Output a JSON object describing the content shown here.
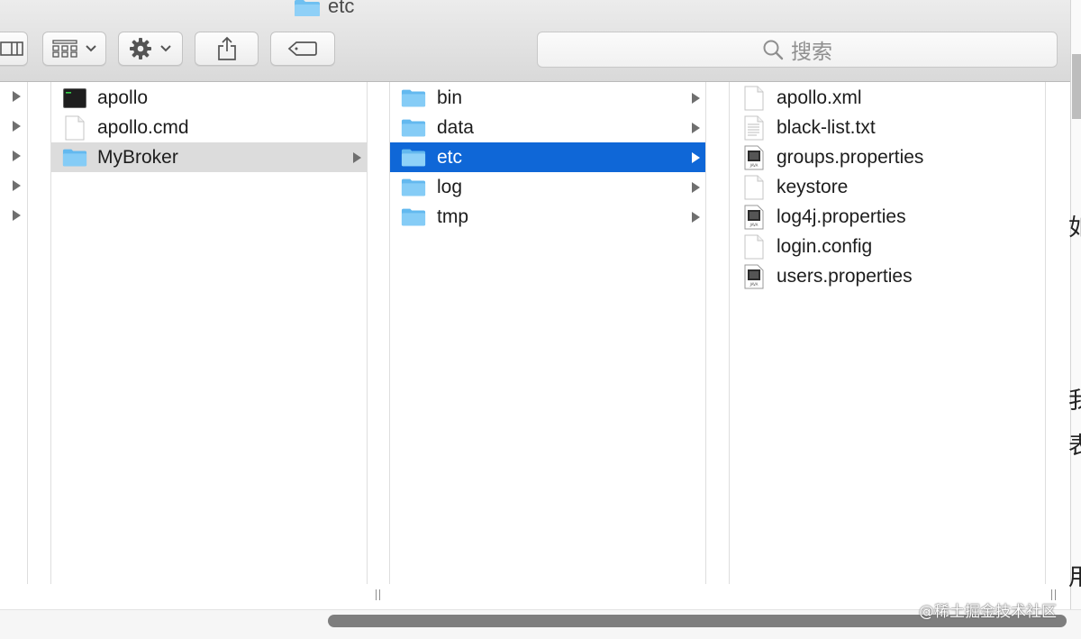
{
  "window": {
    "title": "etc"
  },
  "toolbar": {
    "view_button_icon": "column-view-icon",
    "arrange_button_icon": "grid-arrange-icon",
    "action_button_icon": "gear-icon",
    "share_button_icon": "share-icon",
    "tags_button_icon": "tag-icon",
    "search_placeholder": "搜索",
    "search_icon": "magnifier-icon"
  },
  "sidebar": {
    "arrow_count": 5
  },
  "columns": [
    {
      "items": [
        {
          "label": "apollo",
          "icon": "terminal-exec-icon",
          "has_arrow": false,
          "selected": "none"
        },
        {
          "label": "apollo.cmd",
          "icon": "document-icon",
          "has_arrow": false,
          "selected": "none"
        },
        {
          "label": "MyBroker",
          "icon": "folder-icon",
          "has_arrow": true,
          "selected": "inactive"
        }
      ]
    },
    {
      "items": [
        {
          "label": "bin",
          "icon": "folder-icon",
          "has_arrow": true,
          "selected": "none"
        },
        {
          "label": "data",
          "icon": "folder-icon",
          "has_arrow": true,
          "selected": "none"
        },
        {
          "label": "etc",
          "icon": "folder-icon",
          "has_arrow": true,
          "selected": "active"
        },
        {
          "label": "log",
          "icon": "folder-icon",
          "has_arrow": true,
          "selected": "none"
        },
        {
          "label": "tmp",
          "icon": "folder-icon",
          "has_arrow": true,
          "selected": "none"
        }
      ]
    },
    {
      "items": [
        {
          "label": "apollo.xml",
          "icon": "document-icon",
          "has_arrow": false,
          "selected": "none"
        },
        {
          "label": "black-list.txt",
          "icon": "text-document-icon",
          "has_arrow": false,
          "selected": "none"
        },
        {
          "label": "groups.properties",
          "icon": "java-file-icon",
          "has_arrow": false,
          "selected": "none"
        },
        {
          "label": "keystore",
          "icon": "document-icon",
          "has_arrow": false,
          "selected": "none"
        },
        {
          "label": "log4j.properties",
          "icon": "java-file-icon",
          "has_arrow": false,
          "selected": "none"
        },
        {
          "label": "login.config",
          "icon": "document-icon",
          "has_arrow": false,
          "selected": "none"
        },
        {
          "label": "users.properties",
          "icon": "java-file-icon",
          "has_arrow": false,
          "selected": "none"
        }
      ]
    }
  ],
  "colors": {
    "selection_active": "#0f67d7",
    "selection_inactive": "#dcdcdc",
    "folder": "#79c6f3"
  },
  "background_doc": {
    "edge_chars": [
      "如",
      "我",
      "表",
      "用"
    ]
  },
  "watermark": "@稀土掘金技术社区"
}
